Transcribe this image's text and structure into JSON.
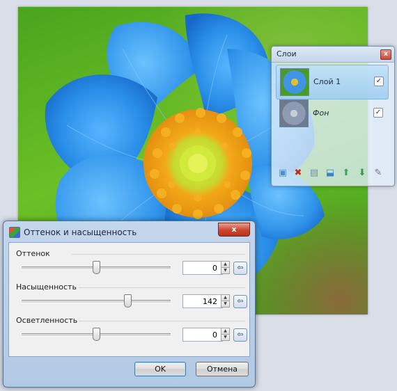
{
  "layers_panel": {
    "title": "Слои",
    "layers": [
      {
        "name": "Слой 1",
        "visible": true,
        "selected": true,
        "italic": false
      },
      {
        "name": "Фон",
        "visible": true,
        "selected": false,
        "italic": true
      }
    ],
    "toolbar": [
      {
        "name": "add-layer-icon",
        "glyph": "▣",
        "color": "#4a8fd4"
      },
      {
        "name": "delete-layer-icon",
        "glyph": "✖",
        "color": "#c0282a"
      },
      {
        "name": "duplicate-layer-icon",
        "glyph": "▤",
        "color": "#6c8fb8"
      },
      {
        "name": "merge-down-icon",
        "glyph": "⬓",
        "color": "#3b7fcf"
      },
      {
        "name": "move-up-icon",
        "glyph": "⬆",
        "color": "#3aa45a"
      },
      {
        "name": "move-down-icon",
        "glyph": "⬇",
        "color": "#2e9a4e"
      },
      {
        "name": "layer-properties-icon",
        "glyph": "✎",
        "color": "#6b7a8c"
      }
    ]
  },
  "dialog": {
    "title": "Оттенок и насыщенность",
    "close_glyph": "x",
    "sliders": [
      {
        "label": "Оттенок",
        "value": "0",
        "level": 0.5
      },
      {
        "label": "Насыщенность",
        "value": "142",
        "level": 0.71
      },
      {
        "label": "Осветленность",
        "value": "0",
        "level": 0.5
      }
    ],
    "ok_label": "OK",
    "cancel_label": "Отмена"
  },
  "colors": {
    "petal": "#2a8fe8",
    "petal_dark": "#1565c8",
    "stamen": "#f2a516",
    "pistil": "#c9e02a",
    "background": "#5cb423"
  }
}
